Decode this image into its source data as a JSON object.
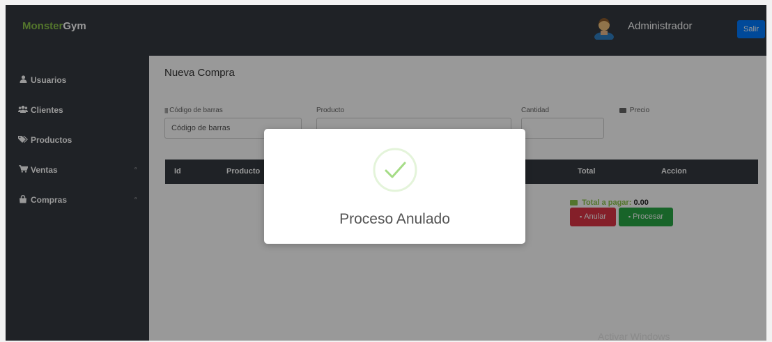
{
  "header": {
    "brand_part1": "Monster",
    "brand_part2": "Gym",
    "user_name": "Administrador",
    "logout_label": "Salir"
  },
  "sidebar": {
    "items": [
      {
        "icon": "user-icon",
        "label": "Usuarios"
      },
      {
        "icon": "users-icon",
        "label": "Clientes"
      },
      {
        "icon": "tags-icon",
        "label": "Productos"
      },
      {
        "icon": "cart-icon",
        "label": "Ventas",
        "caret": "▫"
      },
      {
        "icon": "bag-icon",
        "label": "Compras",
        "caret": "▫"
      }
    ]
  },
  "page": {
    "title": "Nueva Compra",
    "fields": {
      "barcode_label": "Código de barras",
      "barcode_placeholder": "Código de barras",
      "product_label": "Producto",
      "quantity_label": "Cantidad",
      "price_label": "Precio"
    },
    "table": {
      "columns": [
        "Id",
        "Producto",
        "Total",
        "Accion"
      ]
    },
    "total_label": "Total a pagar:",
    "total_value": "0.00",
    "cancel_label": "Anular",
    "process_label": "Procesar"
  },
  "watermark": "Activar Windows",
  "modal": {
    "title": "Proceso Anulado",
    "icon": "success-check-icon"
  },
  "colors": {
    "brand_green": "#8bc34a",
    "dark": "#343a40",
    "primary": "#007bff",
    "danger": "#dc3545",
    "success": "#28a745",
    "success_check": "#a5dc86"
  }
}
